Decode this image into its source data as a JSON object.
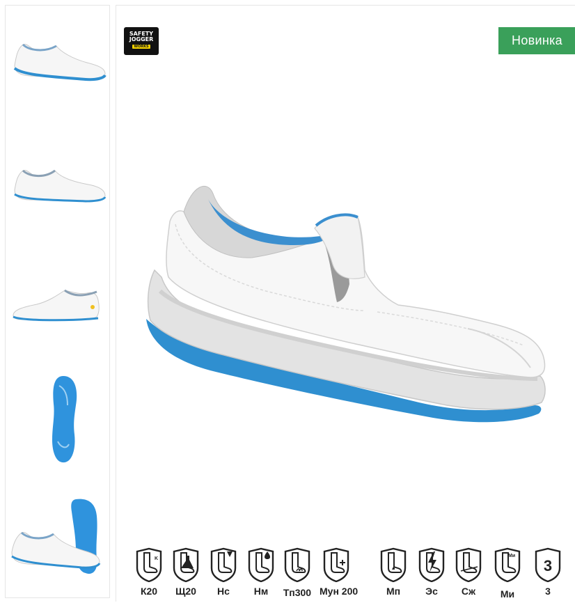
{
  "gallery": {
    "thumbnails": [
      {
        "name": "thumb-side-view-1"
      },
      {
        "name": "thumb-side-view-2"
      },
      {
        "name": "thumb-inner-side-view"
      },
      {
        "name": "thumb-sole-view"
      },
      {
        "name": "thumb-pair-view"
      }
    ]
  },
  "product": {
    "brand": {
      "line1": "SAFETY",
      "line2": "JOGGER",
      "line3": "WORKS"
    },
    "badge": "Новинка",
    "colors": {
      "badge": "#3aa05a",
      "sole_blue": "#2f8fd0",
      "shoe_white": "#f5f5f5"
    }
  },
  "certifications": [
    {
      "label": "К20",
      "icon": "boot-k-icon"
    },
    {
      "label": "Щ20",
      "icon": "boot-chem-icon"
    },
    {
      "label": "Нс",
      "icon": "boot-oil-icon"
    },
    {
      "label": "Нм",
      "icon": "boot-oil-drop-icon"
    },
    {
      "label": "Тп300",
      "icon": "boot-heat-icon"
    },
    {
      "label": "Мун 200",
      "icon": "boot-toe-impact-icon"
    },
    {
      "label": "Мп",
      "icon": "boot-puncture-icon"
    },
    {
      "label": "Эс",
      "icon": "lightning-icon"
    },
    {
      "label": "Сж",
      "icon": "boot-slip-icon"
    },
    {
      "label": "Ми",
      "icon": "boot-mi-icon"
    },
    {
      "label": "3",
      "icon": "shield-3-icon"
    }
  ]
}
